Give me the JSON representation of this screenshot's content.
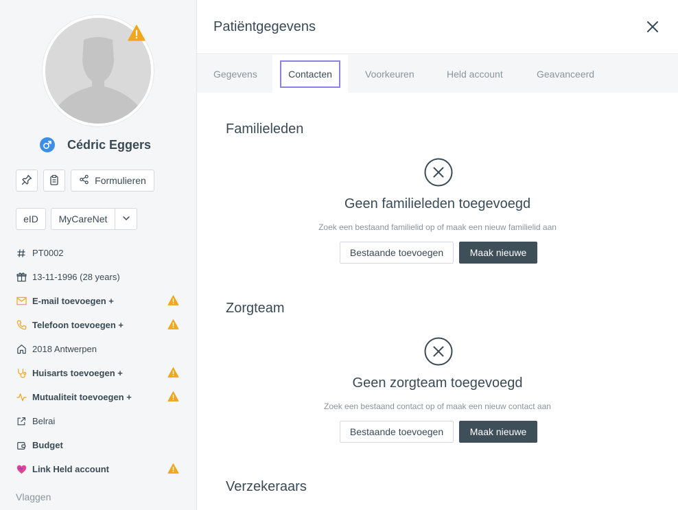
{
  "patient": {
    "name": "Cédric Eggers",
    "gender_icon": "male-icon"
  },
  "actions": {
    "pin_icon": "pin-icon",
    "clipboard_icon": "clipboard-icon",
    "forms_label": "Formulieren",
    "eid_label": "eID",
    "mycarenet_label": "MyCareNet"
  },
  "info": {
    "id": "PT0002",
    "birth": "13-11-1996 (28 years)",
    "email": "E-mail toevoegen +",
    "phone": "Telefoon toevoegen +",
    "address": "2018 Antwerpen",
    "gp": "Huisarts toevoegen +",
    "insurance": "Mutualiteit toevoegen +",
    "belrai": "Belrai",
    "budget": "Budget",
    "held": "Link Held account"
  },
  "sidebar": {
    "flags_label": "Vlaggen"
  },
  "header": {
    "title": "Patiëntgegevens"
  },
  "tabs": [
    {
      "label": "Gegevens"
    },
    {
      "label": "Contacten"
    },
    {
      "label": "Voorkeuren"
    },
    {
      "label": "Held account"
    },
    {
      "label": "Geavanceerd"
    }
  ],
  "family": {
    "title": "Familieleden",
    "empty_title": "Geen familieleden toegevoegd",
    "empty_sub": "Zoek een bestaand familielid op of maak een nieuw familielid aan",
    "btn_existing": "Bestaande toevoegen",
    "btn_new": "Maak nieuwe"
  },
  "careteam": {
    "title": "Zorgteam",
    "empty_title": "Geen zorgteam toegevoegd",
    "empty_sub": "Zoek een bestaand contact op of maak een nieuw contact aan",
    "btn_existing": "Bestaande toevoegen",
    "btn_new": "Maak nieuwe"
  },
  "insurers": {
    "title": "Verzekeraars"
  },
  "colors": {
    "accent_dark": "#3f4f5a",
    "warning": "#f0a61f",
    "active_tab_outline": "#8b80e6",
    "gender_blue": "#3d8ee6",
    "held_pink": "#e2448f"
  }
}
